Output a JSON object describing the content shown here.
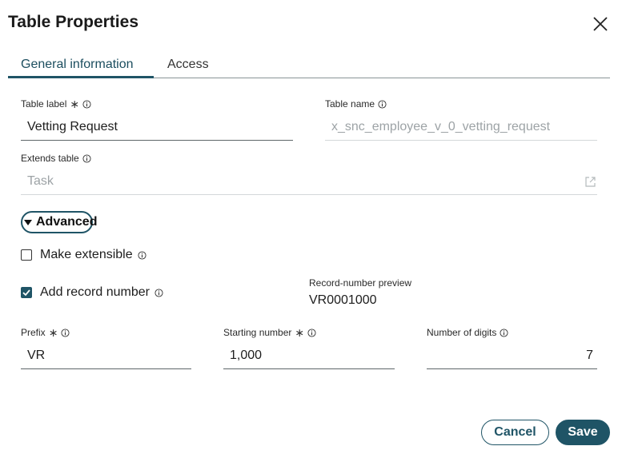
{
  "dialog": {
    "title": "Table Properties"
  },
  "tabs": [
    {
      "label": "General information"
    },
    {
      "label": "Access"
    }
  ],
  "fields": {
    "table_label": {
      "label": "Table label",
      "value": "Vetting Request"
    },
    "table_name": {
      "label": "Table name",
      "value": "x_snc_employee_v_0_vetting_request"
    },
    "extends_table": {
      "label": "Extends table",
      "value": "Task"
    }
  },
  "advanced": {
    "label": "Advanced"
  },
  "options": {
    "make_extensible": {
      "label": "Make extensible",
      "checked": false
    },
    "add_record_number": {
      "label": "Add record number",
      "checked": true
    }
  },
  "record_preview": {
    "label": "Record-number preview",
    "value": "VR0001000"
  },
  "numbering": {
    "prefix": {
      "label": "Prefix",
      "value": "VR"
    },
    "starting_number": {
      "label": "Starting number",
      "value": "1,000"
    },
    "number_of_digits": {
      "label": "Number of digits",
      "value": "7"
    }
  },
  "buttons": {
    "cancel": "Cancel",
    "save": "Save"
  },
  "colors": {
    "accent": "#1f5466",
    "muted_text": "#9da3a6"
  }
}
